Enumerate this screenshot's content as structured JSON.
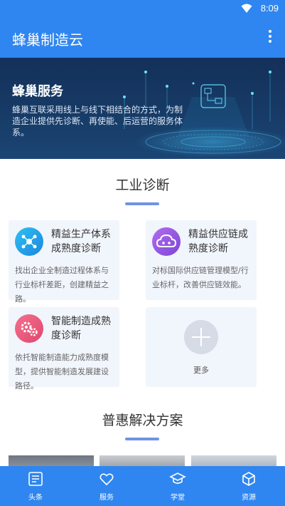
{
  "status_bar": {
    "time": "8:09",
    "wifi_icon": "wifi-icon"
  },
  "app_bar": {
    "title": "蜂巢制造云",
    "menu_icon": "more-vertical-icon"
  },
  "banner": {
    "title": "蜂巢服务",
    "description": "蜂巢互联采用线上与线下相结合的方式，为制造企业提供先诊断、再使能、后运营的服务体系。"
  },
  "diagnosis": {
    "title": "工业诊断",
    "cards": [
      {
        "title": "精益生产体系成熟度诊断",
        "desc": "找出企业全制造过程体系与行业标杆差距，创建精益之路。",
        "icon": "network-icon",
        "color": "#2aa6e8"
      },
      {
        "title": "精益供应链成熟度诊断",
        "desc": "对标国际供应链管理模型/行业标杆，改善供应链效能。",
        "icon": "cloud-icon",
        "color": "#9b5ce0"
      },
      {
        "title": "智能制造成熟度诊断",
        "desc": "依托智能制造能力成熟度模型，提供智能制造发展建设路径。",
        "icon": "gears-icon",
        "color": "#ec5b7f"
      }
    ],
    "more_label": "更多",
    "more_icon": "plus-icon"
  },
  "solutions": {
    "title": "普惠解决方案"
  },
  "tabbar": {
    "items": [
      {
        "label": "头条",
        "icon": "news-icon"
      },
      {
        "label": "服务",
        "icon": "heart-icon"
      },
      {
        "label": "学堂",
        "icon": "graduation-cap-icon"
      },
      {
        "label": "资源",
        "icon": "cube-icon"
      }
    ]
  },
  "colors": {
    "primary": "#2f86f0",
    "card_bg": "#f1f5fc",
    "accent_bar": "#6f93e6"
  }
}
